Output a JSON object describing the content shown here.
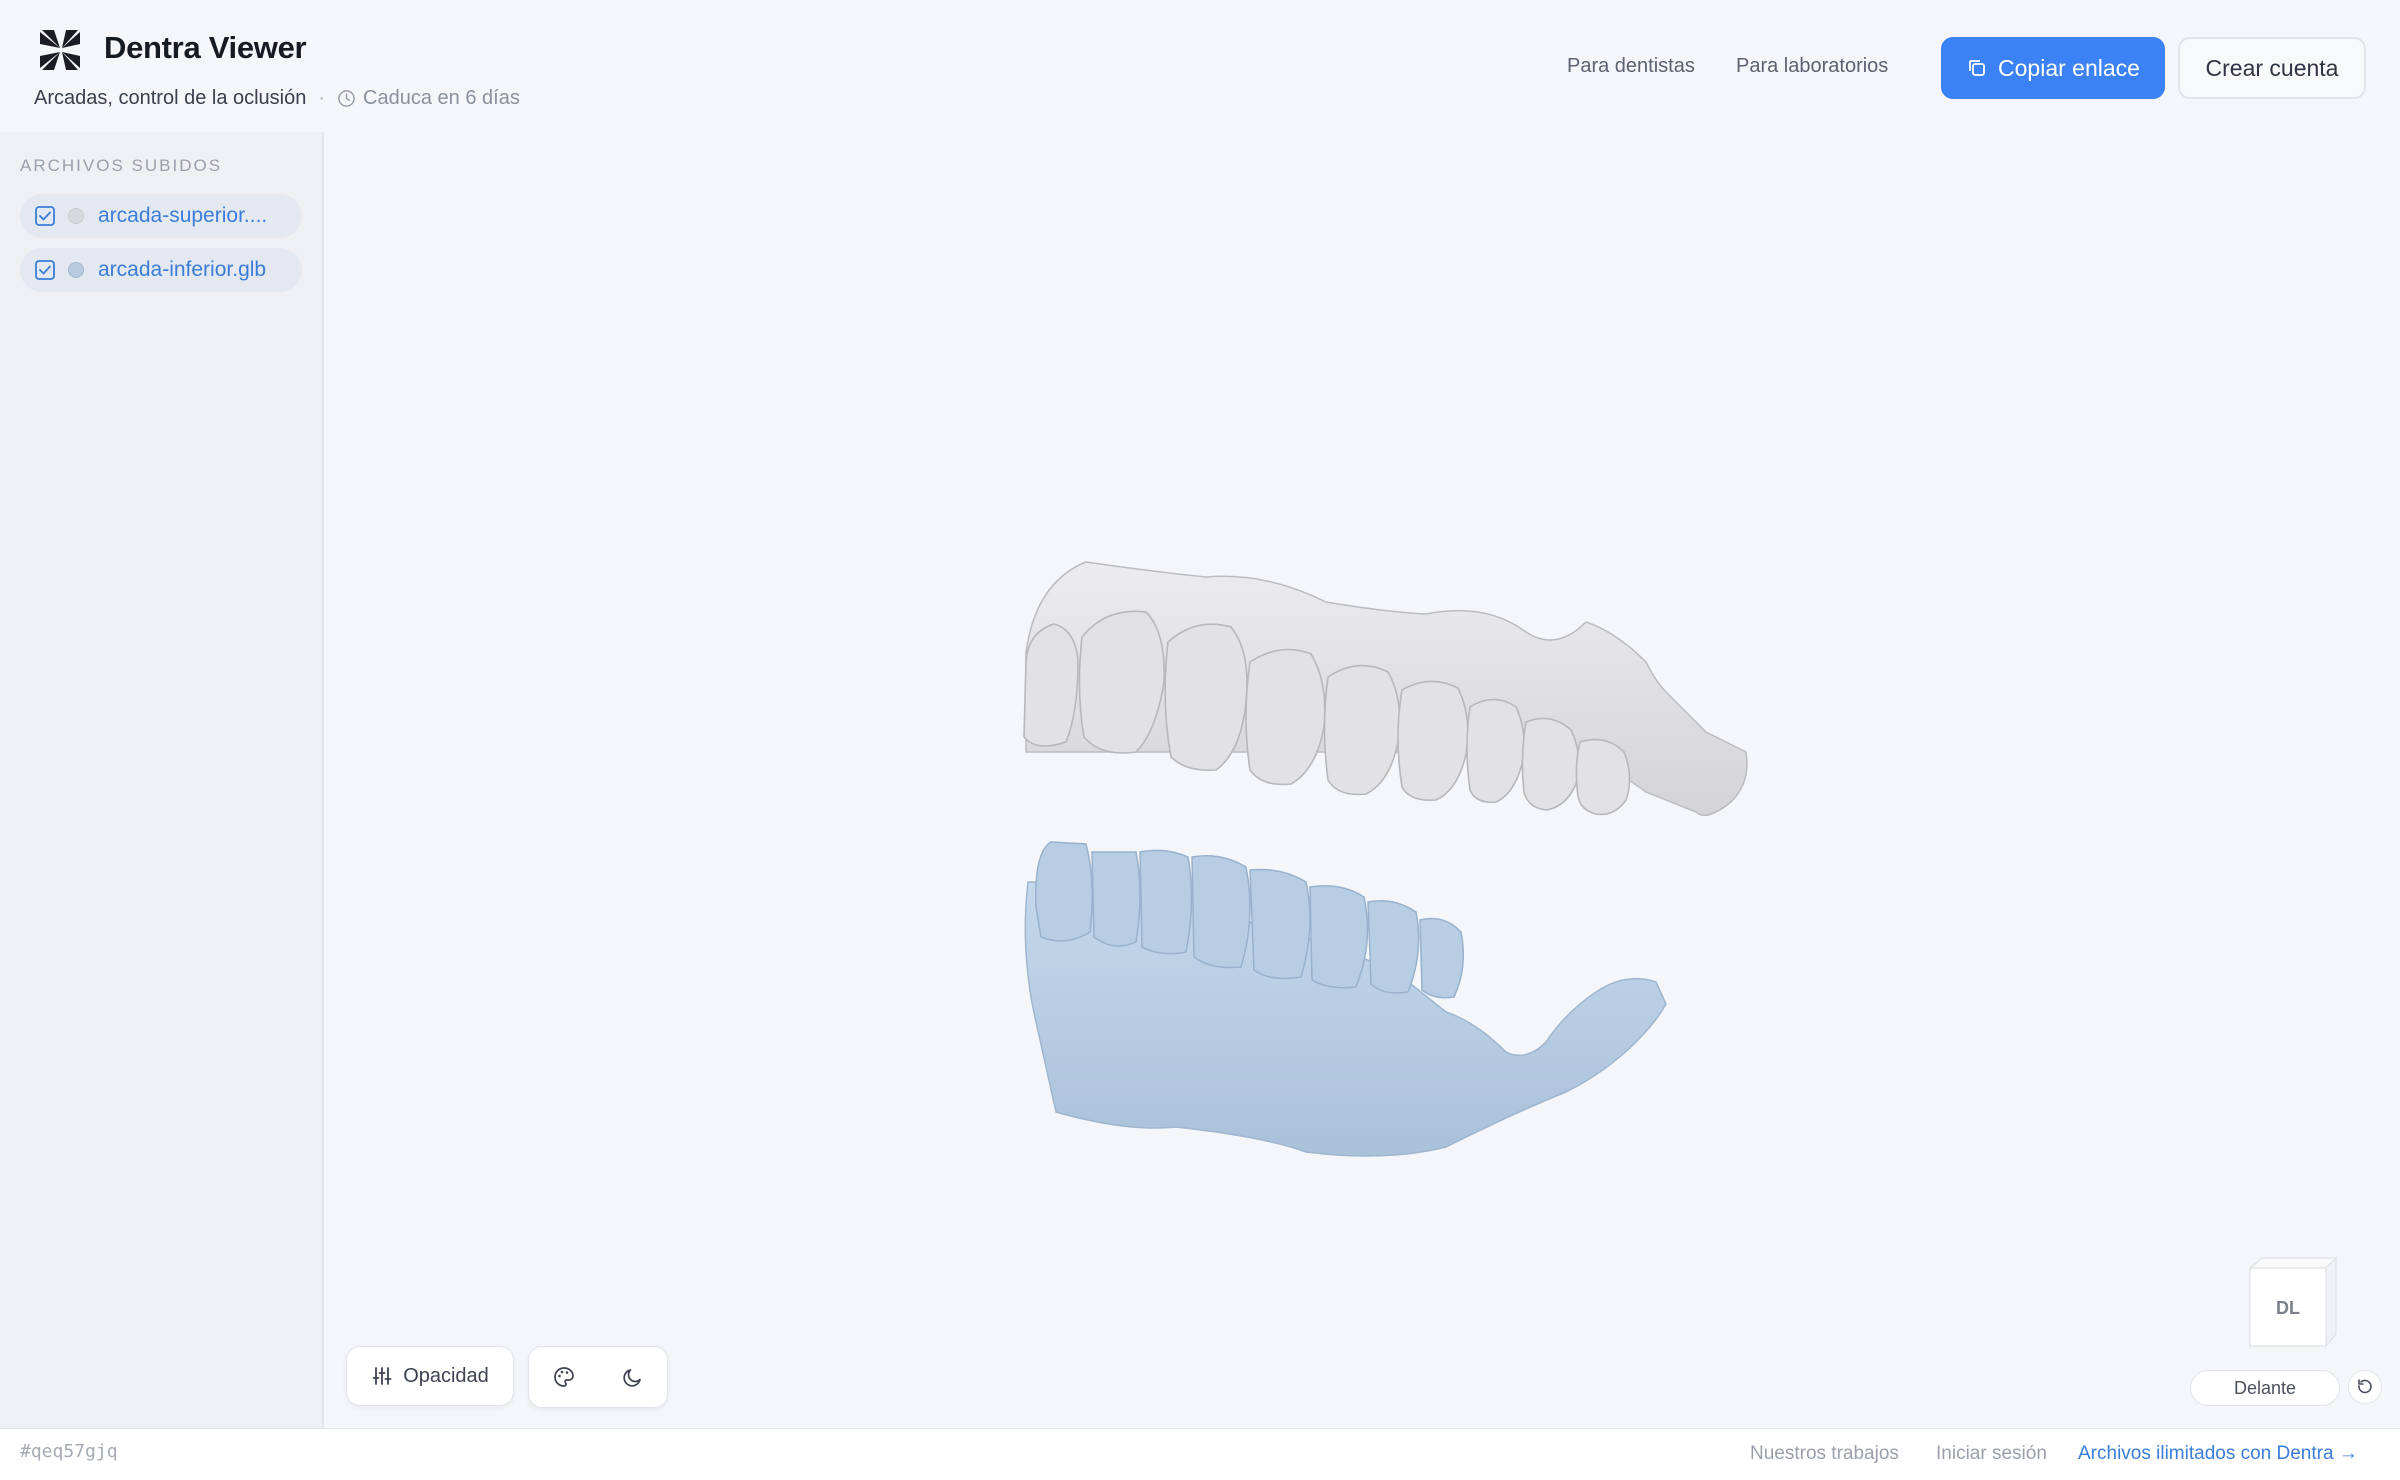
{
  "app": {
    "title": "Dentra Viewer",
    "logo_icon": "dentra-logo-icon"
  },
  "session": {
    "title": "Arcadas, control de la oclusión",
    "separator": "·",
    "expires": "Caduca en 6 días",
    "id": "#qeq57gjq"
  },
  "nav": {
    "dentists": "Para dentistas",
    "labs": "Para laboratorios",
    "copy_link": "Copiar enlace",
    "create_account": "Crear cuenta"
  },
  "sidebar": {
    "heading": "ARCHIVOS SUBIDOS",
    "files": [
      {
        "name": "arcada-superior.glb",
        "display": "arcada-superior....",
        "checked": true,
        "color": "#d6d8dc"
      },
      {
        "name": "arcada-inferior.glb",
        "display": "arcada-inferior.glb",
        "checked": true,
        "color": "#b9cbe0"
      }
    ]
  },
  "viewer": {
    "opacity_label": "Opacidad",
    "view_cube_face": "DL",
    "view_name": "Delante",
    "upper_arch_color": "#e4e4e6",
    "lower_arch_color": "#bcd2e8"
  },
  "footer": {
    "our_work": "Nuestros trabajos",
    "login": "Iniciar sesión",
    "cta": "Archivos ilimitados con Dentra →"
  },
  "colors": {
    "accent": "#3b82f6",
    "link": "#3b7dd8",
    "background": "#f4f6fa"
  }
}
